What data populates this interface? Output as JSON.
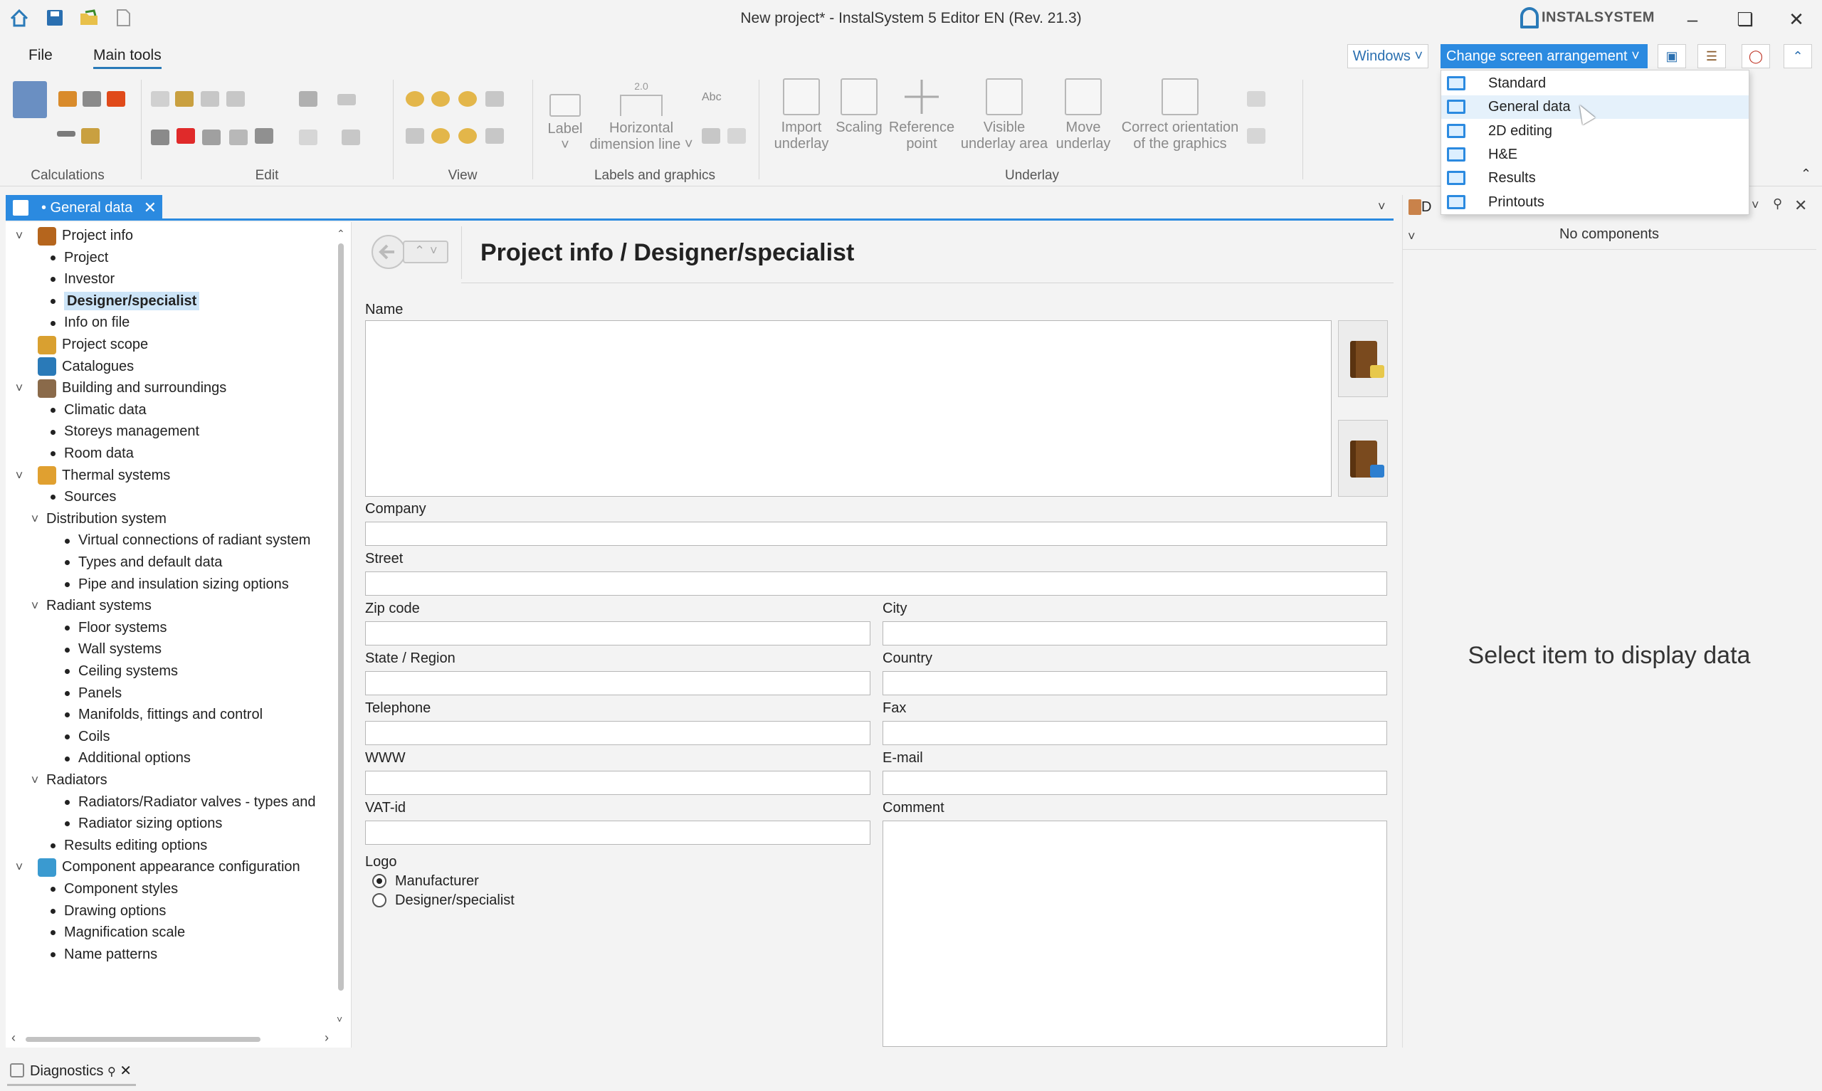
{
  "window": {
    "title": "New project* - InstalSystem 5 Editor EN (Rev. 21.3)",
    "brand": "INSTALSYSTEM"
  },
  "ribbon_tabs": [
    "File",
    "Main tools"
  ],
  "toolbar_right": {
    "windows_label": "Windows",
    "arrangement_label": "Change screen arrangement"
  },
  "arrangement_menu": {
    "items": [
      "Standard",
      "General data",
      "2D editing",
      "H&E",
      "Results",
      "Printouts"
    ],
    "hovered": "General data"
  },
  "ribbon": {
    "groups": [
      "Calculations",
      "Edit",
      "View",
      "Labels and graphics",
      "Underlay"
    ],
    "label_tools": {
      "label": "Label",
      "horizontal_dimension_line_1": "Horizontal",
      "horizontal_dimension_line_2": "dimension line",
      "abc": "Abc",
      "dim_value": "2.0"
    },
    "underlay_tools": [
      {
        "line1": "Import",
        "line2": "underlay"
      },
      {
        "line1": "Scaling",
        "line2": ""
      },
      {
        "line1": "Reference",
        "line2": "point"
      },
      {
        "line1": "Visible",
        "line2": "underlay area"
      },
      {
        "line1": "Move",
        "line2": "underlay"
      },
      {
        "line1": "Correct orientation",
        "line2": "of the graphics"
      }
    ]
  },
  "doc_tab": {
    "label": "• General data"
  },
  "tree": {
    "items": [
      {
        "label": "Project info",
        "level": 0,
        "toggle": "v"
      },
      {
        "label": "Project",
        "level": 1
      },
      {
        "label": "Investor",
        "level": 1
      },
      {
        "label": "Designer/specialist",
        "level": 1,
        "selected": true
      },
      {
        "label": "Info on file",
        "level": 1
      },
      {
        "label": "Project scope",
        "level": 0
      },
      {
        "label": "Catalogues",
        "level": 0
      },
      {
        "label": "Building and surroundings",
        "level": 0,
        "toggle": "v"
      },
      {
        "label": "Climatic data",
        "level": 1
      },
      {
        "label": "Storeys management",
        "level": 1
      },
      {
        "label": "Room data",
        "level": 1
      },
      {
        "label": "Thermal systems",
        "level": 0,
        "toggle": "v"
      },
      {
        "label": "Sources",
        "level": 1
      },
      {
        "label": "Distribution system",
        "level": 1,
        "toggle": "v",
        "folder": true
      },
      {
        "label": "Virtual connections of radiant system",
        "level": 2
      },
      {
        "label": "Types and default data",
        "level": 2
      },
      {
        "label": "Pipe and insulation sizing options",
        "level": 2
      },
      {
        "label": "Radiant systems",
        "level": 1,
        "toggle": "v",
        "folder": true
      },
      {
        "label": "Floor systems",
        "level": 2
      },
      {
        "label": "Wall systems",
        "level": 2
      },
      {
        "label": "Ceiling systems",
        "level": 2
      },
      {
        "label": "Panels",
        "level": 2
      },
      {
        "label": "Manifolds, fittings and control",
        "level": 2
      },
      {
        "label": "Coils",
        "level": 2
      },
      {
        "label": "Additional options",
        "level": 2
      },
      {
        "label": "Radiators",
        "level": 1,
        "toggle": "v",
        "folder": true
      },
      {
        "label": "Radiators/Radiator valves - types and",
        "level": 2
      },
      {
        "label": "Radiator sizing options",
        "level": 2
      },
      {
        "label": "Results editing options",
        "level": 1
      },
      {
        "label": "Component appearance configuration",
        "level": 0,
        "toggle": "v"
      },
      {
        "label": "Component styles",
        "level": 1
      },
      {
        "label": "Drawing options",
        "level": 1
      },
      {
        "label": "Magnification scale",
        "level": 1
      },
      {
        "label": "Name patterns",
        "level": 1
      }
    ]
  },
  "form": {
    "title": "Project info / Designer/specialist",
    "name_label": "Name",
    "company_label": "Company",
    "street_label": "Street",
    "zip_label": "Zip code",
    "city_label": "City",
    "state_label": "State / Region",
    "country_label": "Country",
    "telephone_label": "Telephone",
    "fax_label": "Fax",
    "www_label": "WWW",
    "email_label": "E-mail",
    "vat_label": "VAT-id",
    "comment_label": "Comment",
    "logo_label": "Logo",
    "logo_options": [
      "Manufacturer",
      "Designer/specialist"
    ],
    "logo_selected": "Manufacturer"
  },
  "right_panel": {
    "header_initial": "D",
    "no_components": "No components",
    "select_message": "Select item to display data"
  },
  "bottom": {
    "diagnostics_label": "Diagnostics"
  }
}
